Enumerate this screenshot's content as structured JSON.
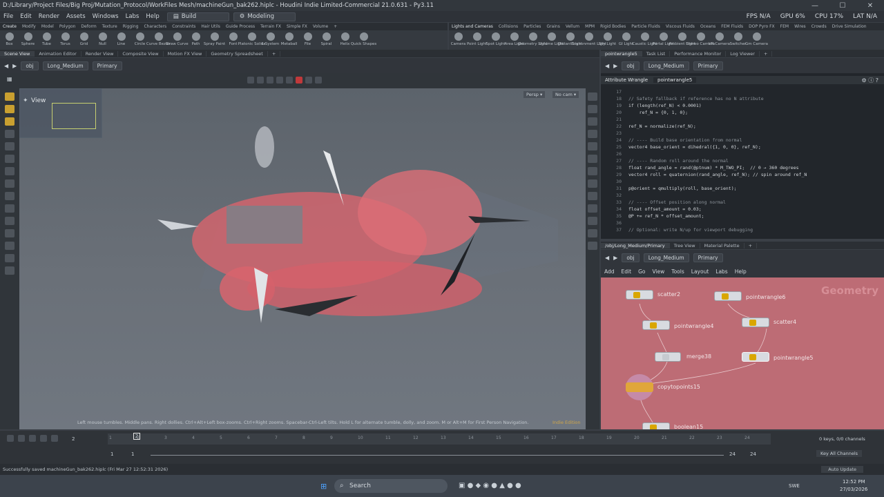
{
  "window": {
    "title": "D:/Library/Project Files/Big Proj/Mutation_Protocol/WorkFiles Mesh/machineGun_bak262.hiplc - Houdini Indie Limited-Commercial 21.0.631 - Py3.11",
    "min": "—",
    "max": "☐",
    "close": "✕"
  },
  "menu": [
    "File",
    "Edit",
    "Render",
    "Assets",
    "Windows",
    "Labs",
    "Help"
  ],
  "desktop": "Build",
  "context": "Modeling",
  "perf": {
    "fps": "FPS N/A",
    "gpu": "GPU 6%",
    "cpu": "CPU 17%",
    "lat": "LAT N/A"
  },
  "shelf_tabs_left": [
    "Create",
    "Modify",
    "Model",
    "Polygon",
    "Deform",
    "Texture",
    "Rigging",
    "Characters",
    "Constraints",
    "Hair Utils",
    "Guide Process",
    "Terrain FX",
    "Simple FX",
    "Volume",
    "+"
  ],
  "shelf_tabs_right": [
    "Lights and Cameras",
    "Collisions",
    "Particles",
    "Grains",
    "Vellum",
    "MPM",
    "Rigid Bodies",
    "Particle Fluids",
    "Viscous Fluids",
    "Oceans",
    "FEM Fluids",
    "DOP Pyro FX",
    "FEM",
    "Wires",
    "Crowds",
    "Drive Simulation"
  ],
  "shelf_tools_left": [
    "Box",
    "Sphere",
    "Tube",
    "Torus",
    "Grid",
    "Null",
    "Line",
    "Circle",
    "Curve Bezier",
    "Draw Curve",
    "Path",
    "Spray Paint",
    "Font",
    "Platonic Solids",
    "L-System",
    "Metaball",
    "File",
    "Spiral",
    "Helix",
    "Quick Shapes"
  ],
  "shelf_tools_right": [
    "Camera",
    "Point Light",
    "Spot Light",
    "Area Light",
    "Geometry Light",
    "Volume Light",
    "Distant Light",
    "Environment Light",
    "Sky Light",
    "GI Light",
    "Caustic Light",
    "Portal Light",
    "Ambient Light",
    "Stereo Camera",
    "VR Camera",
    "Switcher",
    "Gm Camera"
  ],
  "pane_tabs_left": [
    "Scene View",
    "Animation Editor",
    "Render View",
    "Composite View",
    "Motion FX View",
    "Geometry Spreadsheet",
    "+"
  ],
  "pane_tabs_right": [
    "pointwrangle5",
    "Task List",
    "Performance Monitor",
    "Log Viewer",
    "+"
  ],
  "path": {
    "obj": "obj",
    "geo": "Long_Medium",
    "node": "Primary"
  },
  "viewport": {
    "view_label": "View",
    "persp": "Persp ▾",
    "cam": "No cam ▾",
    "hint": "Left mouse tumbles. Middle pans. Right dollies. Ctrl+Alt+Left box-zooms. Ctrl+Right zooms. Spacebar-Ctrl-Left tilts. Hold L for alternate tumble, dolly, and zoom. M or Alt+M for First Person Navigation.",
    "shade": "Indie Edition"
  },
  "wrangle": {
    "type": "Attribute Wrangle",
    "name": "pointwrangle5",
    "lines": [
      {
        "n": "17",
        "t": ""
      },
      {
        "n": "18",
        "t": "// Safety fallback if reference has no N attribute",
        "c": true
      },
      {
        "n": "19",
        "t": "if (length(ref_N) < 0.0001)"
      },
      {
        "n": "20",
        "t": "    ref_N = {0, 1, 0};"
      },
      {
        "n": "21",
        "t": ""
      },
      {
        "n": "22",
        "t": "ref_N = normalize(ref_N);"
      },
      {
        "n": "23",
        "t": ""
      },
      {
        "n": "24",
        "t": "// ---- Build base orientation from normal",
        "c": true
      },
      {
        "n": "25",
        "t": "vector4 base_orient = dihedral({1, 0, 0}, ref_N);"
      },
      {
        "n": "26",
        "t": ""
      },
      {
        "n": "27",
        "t": "// ---- Random roll around the normal",
        "c": true
      },
      {
        "n": "28",
        "t": "float rand_angle = rand(@ptnum) * M_TWO_PI;  // 0 → 360 degrees"
      },
      {
        "n": "29",
        "t": "vector4 roll = quaternion(rand_angle, ref_N); // spin around ref_N"
      },
      {
        "n": "30",
        "t": ""
      },
      {
        "n": "31",
        "t": "p@orient = qmultiply(roll, base_orient);"
      },
      {
        "n": "32",
        "t": ""
      },
      {
        "n": "33",
        "t": "// ---- Offset position along normal",
        "c": true
      },
      {
        "n": "34",
        "t": "float offset_amount = 0.03;"
      },
      {
        "n": "35",
        "t": "@P += ref_N * offset_amount;"
      },
      {
        "n": "36",
        "t": ""
      },
      {
        "n": "37",
        "t": "// Optional: write N/up for viewport debugging",
        "c": true
      }
    ]
  },
  "net_tabs": [
    "/obj/Long_Medium/Primary",
    "Tree View",
    "Material Palette",
    "+"
  ],
  "net_menu": [
    "Add",
    "Edit",
    "Go",
    "View",
    "Tools",
    "Layout",
    "Labs",
    "Help"
  ],
  "net_watermark": "Geometry",
  "nodes": [
    {
      "name": "scatter2"
    },
    {
      "name": "pointwrangle6"
    },
    {
      "name": "pointwrangle4"
    },
    {
      "name": "scatter4"
    },
    {
      "name": "merge38"
    },
    {
      "name": "pointwrangle5"
    },
    {
      "name": "copytopoints15"
    },
    {
      "name": "boolean15"
    }
  ],
  "timeline": {
    "frame": "2",
    "start": "1",
    "start2": "1",
    "end": "24",
    "end2": "24",
    "ticks": [
      "1",
      "2",
      "3",
      "4",
      "5",
      "6",
      "7",
      "8",
      "9",
      "10",
      "11",
      "12",
      "13",
      "14",
      "15",
      "16",
      "17",
      "18",
      "19",
      "20",
      "21",
      "22",
      "23",
      "24"
    ],
    "keys": "0 keys, 0/0 channels",
    "channels": "Key All Channels",
    "autoupdate": "Auto Update"
  },
  "status": "Successfully saved machineGun_bak262.hiplc (Fri Mar 27 12:52:31 2026)",
  "taskbar": {
    "search": "Search",
    "lang": "SWE",
    "time": "12:52 PM",
    "date": "27/03/2026"
  }
}
